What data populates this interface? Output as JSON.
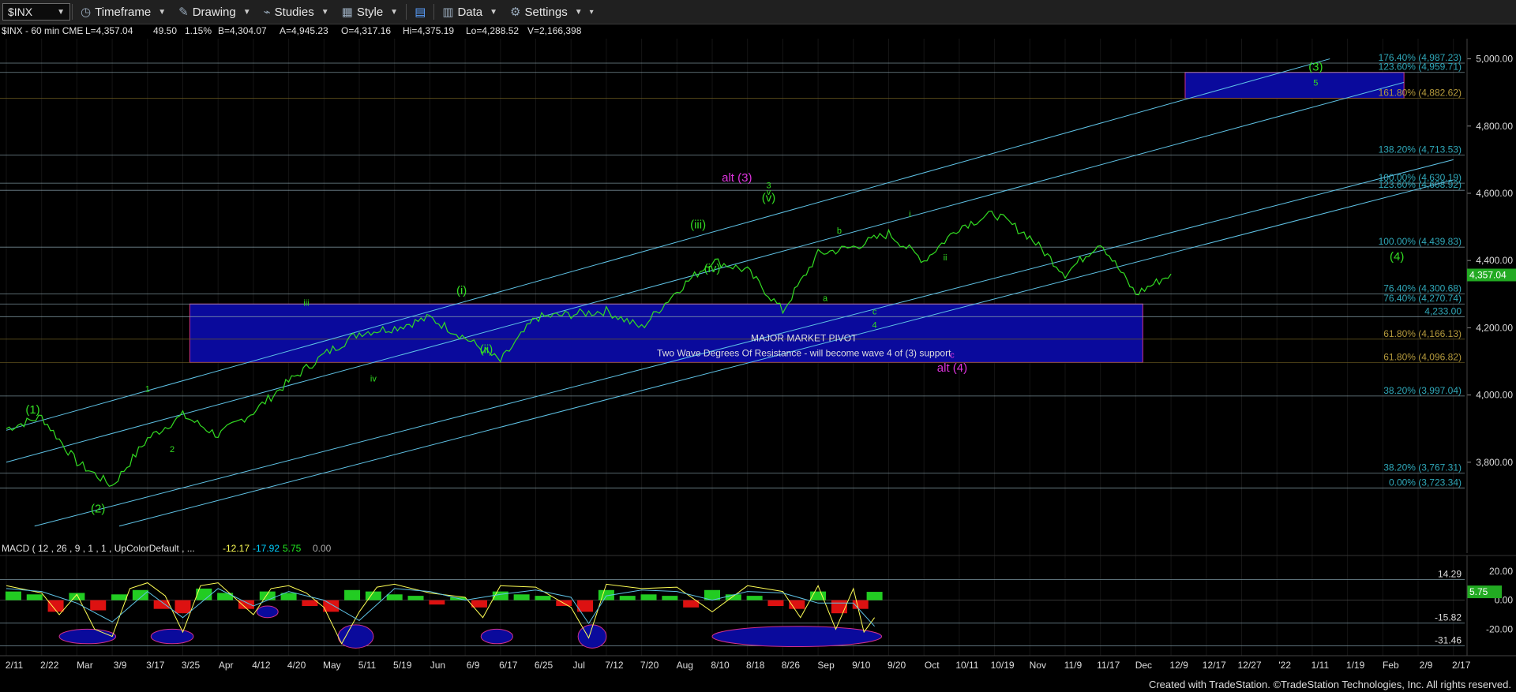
{
  "toolbar": {
    "symbol": "$INX",
    "timeframe": "Timeframe",
    "drawing": "Drawing",
    "studies": "Studies",
    "style": "Style",
    "data": "Data",
    "settings": "Settings"
  },
  "header": {
    "symbol_line": "$INX - 60 min  CME",
    "last": "L=4,357.04",
    "change": "49.50",
    "pct": "1.15%",
    "bid": "B=4,304.07",
    "ask": "A=4,945.23",
    "open": "O=4,317.16",
    "high": "Hi=4,375.19",
    "low": "Lo=4,288.52",
    "volume": "V=2,166,398"
  },
  "colors": {
    "price": "#33dd22",
    "channel": "#5fc3e6",
    "fib": "#2fa7b8",
    "fib_gold": "#b59a3c",
    "zone_fill": "#0a0a9c",
    "zone_border": "#d0308a",
    "alt_label": "#dd33dd",
    "wave_label": "#33dd22",
    "macd_line": "#ffff55",
    "hist_pos": "#22cc22",
    "hist_neg": "#dd1111",
    "last_tag": "#22aa22"
  },
  "chart_data": [
    {
      "type": "line",
      "title": "",
      "ylim": [
        3600,
        5060
      ],
      "y_ticks": [
        "5,000.00",
        "4,800.00",
        "4,600.00",
        "4,400.00",
        "4,200.00",
        "4,000.00",
        "3,800.00"
      ],
      "x_labels": [
        "2/11",
        "2/22",
        "Mar",
        "3/9",
        "3/17",
        "3/25",
        "Apr",
        "4/12",
        "4/20",
        "May",
        "5/11",
        "5/19",
        "Jun",
        "6/9",
        "6/17",
        "6/25",
        "Jul",
        "7/12",
        "7/20",
        "Aug",
        "8/10",
        "8/18",
        "8/26",
        "Sep",
        "9/10",
        "9/20",
        "Oct",
        "10/11",
        "10/19",
        "Nov",
        "11/9",
        "11/17",
        "Dec",
        "12/9",
        "12/17",
        "12/27",
        "'22",
        "1/11",
        "1/19",
        "Feb",
        "2/9",
        "2/17"
      ],
      "series": [
        {
          "points": [
            [
              0,
              3900
            ],
            [
              1,
              3935
            ],
            [
              2,
              3800
            ],
            [
              3,
              3730
            ],
            [
              4,
              3870
            ],
            [
              5,
              3940
            ],
            [
              6,
              3880
            ],
            [
              7,
              3950
            ],
            [
              8,
              4040
            ],
            [
              9,
              4120
            ],
            [
              10,
              4185
            ],
            [
              11,
              4200
            ],
            [
              12,
              4230
            ],
            [
              13,
              4170
            ],
            [
              14,
              4100
            ],
            [
              15,
              4230
            ],
            [
              16,
              4240
            ],
            [
              17,
              4250
            ],
            [
              18,
              4200
            ],
            [
              19,
              4310
            ],
            [
              20,
              4400
            ],
            [
              21,
              4370
            ],
            [
              22,
              4250
            ],
            [
              23,
              4420
            ],
            [
              24,
              4440
            ],
            [
              25,
              4480
            ],
            [
              26,
              4400
            ],
            [
              27,
              4500
            ],
            [
              28,
              4540
            ],
            [
              29,
              4470
            ],
            [
              30,
              4360
            ],
            [
              31,
              4455
            ],
            [
              32,
              4300
            ],
            [
              33,
              4360
            ]
          ]
        }
      ],
      "last_value": "4,357.04",
      "levels": [
        {
          "label": "176.40% (4,987.23)",
          "value": 4987.23,
          "color": "fib"
        },
        {
          "label": "123.60% (4,959.71)",
          "value": 4959.71,
          "color": "fib"
        },
        {
          "label": "161.80% (4,882.62)",
          "value": 4882.62,
          "color": "fib_gold"
        },
        {
          "label": "138.20% (4,713.53)",
          "value": 4713.53,
          "color": "fib"
        },
        {
          "label": "100.00% (4,630.19)",
          "value": 4630.19,
          "color": "fib"
        },
        {
          "label": "123.60% (4,608.92)",
          "value": 4608.92,
          "color": "fib"
        },
        {
          "label": "100.00% (4,439.83)",
          "value": 4439.83,
          "color": "fib"
        },
        {
          "label": "76.40% (4,300.68)",
          "value": 4300.68,
          "color": "fib"
        },
        {
          "label": "76.40% (4,270.74)",
          "value": 4270.74,
          "color": "fib"
        },
        {
          "label": "4,233.00",
          "value": 4233.0,
          "color": "fib"
        },
        {
          "label": "61.80% (4,166.13)",
          "value": 4166.13,
          "color": "fib_gold"
        },
        {
          "label": "61.80% (4,096.82)",
          "value": 4096.82,
          "color": "fib_gold"
        },
        {
          "label": "38.20% (3,997.04)",
          "value": 3997.04,
          "color": "fib"
        },
        {
          "label": "38.20% (3,767.31)",
          "value": 3767.31,
          "color": "fib"
        },
        {
          "label": "0.00% (3,723.34)",
          "value": 3723.34,
          "color": "fib"
        }
      ],
      "zones": [
        {
          "name": "major-market-pivot",
          "x": [
            5.2,
            32.2
          ],
          "y": [
            4096.82,
            4270.74
          ]
        },
        {
          "name": "target",
          "x": [
            33.4,
            39.6
          ],
          "y": [
            4882.62,
            4959.71
          ]
        }
      ],
      "channels": [
        {
          "x": [
            0,
            37.5
          ],
          "y": [
            3895,
            5000
          ]
        },
        {
          "x": [
            0,
            39.6
          ],
          "y": [
            3800,
            4930
          ]
        },
        {
          "x": [
            0.8,
            41
          ],
          "y": [
            3610,
            4700
          ]
        },
        {
          "x": [
            3.2,
            41
          ],
          "y": [
            3610,
            4640
          ]
        }
      ],
      "annotations": [
        {
          "text": "MAJOR MARKET PIVOT",
          "x": 22.6,
          "y": 4160,
          "color": "#dddddd"
        },
        {
          "text": "Two Wave Degrees Of Resistance - will become wave 4 of (3) support",
          "x": 22.6,
          "y": 4115,
          "color": "#dddddd"
        },
        {
          "text": "alt (3)",
          "x": 20.7,
          "y": 4635,
          "color": "alt_label"
        },
        {
          "text": "alt (4)",
          "x": 26.8,
          "y": 4070,
          "color": "alt_label"
        },
        {
          "text": "c",
          "x": 26.8,
          "y": 4110,
          "color": "alt_label"
        },
        {
          "text": "(1)",
          "x": 0.75,
          "y": 3945,
          "color": "wave_label"
        },
        {
          "text": "(2)",
          "x": 2.6,
          "y": 3650,
          "color": "wave_label"
        },
        {
          "text": "(3)",
          "x": 37.1,
          "y": 4965,
          "color": "wave_label"
        },
        {
          "text": "5",
          "x": 37.1,
          "y": 4920,
          "color": "wave_label"
        },
        {
          "text": "(4)",
          "x": 39.4,
          "y": 4400,
          "color": "wave_label"
        },
        {
          "text": "1",
          "x": 4.0,
          "y": 4010,
          "color": "wave_label"
        },
        {
          "text": "2",
          "x": 4.7,
          "y": 3830,
          "color": "wave_label"
        },
        {
          "text": "iii",
          "x": 8.5,
          "y": 4265,
          "color": "wave_label"
        },
        {
          "text": "iv",
          "x": 10.4,
          "y": 4040,
          "color": "wave_label"
        },
        {
          "text": "(i)",
          "x": 12.9,
          "y": 4300,
          "color": "wave_label"
        },
        {
          "text": "(ii)",
          "x": 13.6,
          "y": 4125,
          "color": "wave_label"
        },
        {
          "text": "(iii)",
          "x": 19.6,
          "y": 4495,
          "color": "wave_label"
        },
        {
          "text": "(iv)",
          "x": 20.0,
          "y": 4365,
          "color": "wave_label"
        },
        {
          "text": "(v)",
          "x": 21.6,
          "y": 4575,
          "color": "wave_label"
        },
        {
          "text": "v",
          "x": 21.6,
          "y": 4595,
          "color": "wave_label"
        },
        {
          "text": "3",
          "x": 21.6,
          "y": 4615,
          "color": "wave_label"
        },
        {
          "text": "a",
          "x": 23.2,
          "y": 4280,
          "color": "wave_label"
        },
        {
          "text": "b",
          "x": 23.6,
          "y": 4480,
          "color": "wave_label"
        },
        {
          "text": "c",
          "x": 24.6,
          "y": 4240,
          "color": "wave_label"
        },
        {
          "text": "4",
          "x": 24.6,
          "y": 4200,
          "color": "wave_label"
        },
        {
          "text": "i",
          "x": 25.6,
          "y": 4530,
          "color": "wave_label"
        },
        {
          "text": "ii",
          "x": 26.6,
          "y": 4400,
          "color": "wave_label"
        }
      ]
    },
    {
      "type": "line",
      "title": "MACD ( 12 , 26 , 9 , 1 , 1 , UpColorDefault , ...",
      "legend_values": [
        "-12.17",
        "-17.92",
        "5.75",
        "0.00"
      ],
      "ylim": [
        -35,
        27
      ],
      "y_ticks": [
        "20.00",
        "0.00",
        "-20.00"
      ],
      "levels": [
        {
          "label": "14.29",
          "value": 14.29
        },
        {
          "label": "-15.82",
          "value": -15.82
        },
        {
          "label": "-31.46",
          "value": -31.46
        }
      ],
      "last_value": "5.75",
      "series": [
        {
          "name": "MACD",
          "points": [
            [
              0,
              10
            ],
            [
              1,
              5
            ],
            [
              1.5,
              -10
            ],
            [
              2,
              4
            ],
            [
              2.5,
              -20
            ],
            [
              3,
              -25
            ],
            [
              3.5,
              8
            ],
            [
              4,
              12
            ],
            [
              4.5,
              3
            ],
            [
              5,
              -22
            ],
            [
              5.5,
              10
            ],
            [
              6,
              12
            ],
            [
              7,
              -10
            ],
            [
              7.5,
              8
            ],
            [
              8,
              10
            ],
            [
              8.5,
              5
            ],
            [
              9,
              -5
            ],
            [
              9.5,
              -30
            ],
            [
              10,
              -8
            ],
            [
              10.5,
              9
            ],
            [
              11,
              11
            ],
            [
              12,
              5
            ],
            [
              13,
              2
            ],
            [
              13.5,
              -12
            ],
            [
              14,
              10
            ],
            [
              15,
              9
            ],
            [
              16,
              -5
            ],
            [
              16.5,
              -26
            ],
            [
              17,
              11
            ],
            [
              18,
              8
            ],
            [
              19,
              9
            ],
            [
              20,
              -8
            ],
            [
              21,
              10
            ],
            [
              22,
              6
            ],
            [
              22.5,
              -12
            ],
            [
              23,
              10
            ],
            [
              23.5,
              -20
            ],
            [
              24,
              8
            ],
            [
              24.3,
              -22
            ],
            [
              24.6,
              -12
            ]
          ]
        },
        {
          "name": "Signal",
          "points": [
            [
              0,
              8
            ],
            [
              1,
              6
            ],
            [
              2,
              -2
            ],
            [
              3,
              -15
            ],
            [
              4,
              6
            ],
            [
              5,
              -12
            ],
            [
              6,
              8
            ],
            [
              7,
              -4
            ],
            [
              8,
              6
            ],
            [
              9,
              0
            ],
            [
              10,
              -14
            ],
            [
              11,
              8
            ],
            [
              12,
              6
            ],
            [
              13,
              0
            ],
            [
              14,
              4
            ],
            [
              15,
              7
            ],
            [
              16,
              2
            ],
            [
              16.5,
              -16
            ],
            [
              17,
              3
            ],
            [
              18,
              7
            ],
            [
              19,
              6
            ],
            [
              20,
              0
            ],
            [
              21,
              6
            ],
            [
              22,
              5
            ],
            [
              23,
              -2
            ],
            [
              24,
              -2
            ],
            [
              24.6,
              -18
            ]
          ]
        }
      ],
      "hist": [
        [
          0.2,
          6
        ],
        [
          0.8,
          4
        ],
        [
          1.4,
          -8
        ],
        [
          2.0,
          5
        ],
        [
          2.6,
          -7
        ],
        [
          3.2,
          4
        ],
        [
          3.8,
          7
        ],
        [
          4.4,
          -6
        ],
        [
          5.0,
          -9
        ],
        [
          5.6,
          8
        ],
        [
          6.2,
          5
        ],
        [
          6.8,
          -6
        ],
        [
          7.4,
          6
        ],
        [
          8.0,
          5
        ],
        [
          8.6,
          -4
        ],
        [
          9.2,
          -8
        ],
        [
          9.8,
          7
        ],
        [
          10.4,
          6
        ],
        [
          11.0,
          4
        ],
        [
          11.6,
          3
        ],
        [
          12.2,
          -3
        ],
        [
          12.8,
          2
        ],
        [
          13.4,
          -5
        ],
        [
          14.0,
          6
        ],
        [
          14.6,
          4
        ],
        [
          15.2,
          3
        ],
        [
          15.8,
          -4
        ],
        [
          16.4,
          -8
        ],
        [
          17.0,
          7
        ],
        [
          17.6,
          3
        ],
        [
          18.2,
          4
        ],
        [
          18.8,
          3
        ],
        [
          19.4,
          -5
        ],
        [
          20.0,
          7
        ],
        [
          20.6,
          4
        ],
        [
          21.2,
          3
        ],
        [
          21.8,
          -4
        ],
        [
          22.4,
          -6
        ],
        [
          23.0,
          6
        ],
        [
          23.6,
          -9
        ],
        [
          24.2,
          -6
        ],
        [
          24.6,
          5.75
        ]
      ],
      "ellipses": [
        [
          2.3,
          -25,
          0.8,
          5
        ],
        [
          4.7,
          -25,
          0.6,
          5
        ],
        [
          7.4,
          -8,
          0.3,
          4
        ],
        [
          9.9,
          -25,
          0.5,
          8
        ],
        [
          13.9,
          -25,
          0.45,
          5
        ],
        [
          16.6,
          -25,
          0.4,
          8
        ],
        [
          22.4,
          -25,
          2.4,
          7
        ]
      ]
    }
  ],
  "footer": "Created with TradeStation. ©TradeStation Technologies, Inc. All rights reserved."
}
